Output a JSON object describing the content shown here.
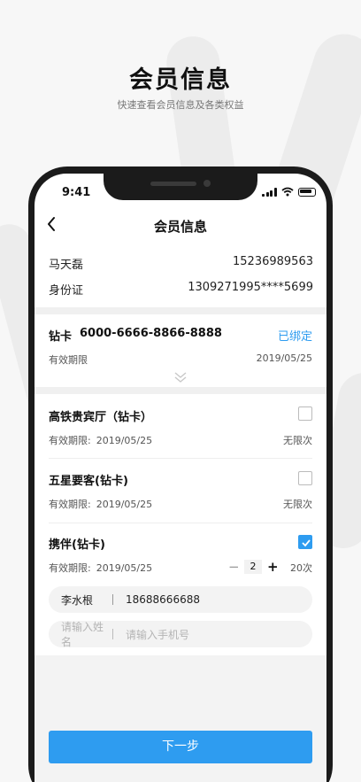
{
  "hero": {
    "title": "会员信息",
    "subtitle": "快速查看会员信息及各类权益"
  },
  "status_bar": {
    "time": "9:41"
  },
  "nav": {
    "title": "会员信息",
    "back_icon": "chevron-left-icon"
  },
  "member": {
    "name": "马天磊",
    "phone": "15236989563",
    "id_label": "身份证",
    "id_number": "1309271995****5699"
  },
  "card": {
    "type": "钻卡",
    "number": "6000-6666-8866-8888",
    "status": "已绑定",
    "valid_label": "有效期限",
    "valid_date": "2019/05/25"
  },
  "benefits": [
    {
      "name": "高铁贵宾厅（钻卡）",
      "valid_label": "有效期限:",
      "valid_date": "2019/05/25",
      "limit": "无限次",
      "checked": false
    },
    {
      "name": "五星要客(钻卡)",
      "valid_label": "有效期限:",
      "valid_date": "2019/05/25",
      "limit": "无限次",
      "checked": false
    },
    {
      "name": "携伴(钻卡)",
      "valid_label": "有效期限:",
      "valid_date": "2019/05/25",
      "quantity": "2",
      "limit": "20次",
      "checked": true
    }
  ],
  "companions": [
    {
      "name": "李水根",
      "phone": "18688666688"
    }
  ],
  "companion_placeholder": {
    "name": "请输入姓名",
    "phone": "请输入手机号"
  },
  "actions": {
    "next_label": "下一步"
  },
  "colors": {
    "accent": "#2e9cf0",
    "frame": "#1b1b1b"
  }
}
